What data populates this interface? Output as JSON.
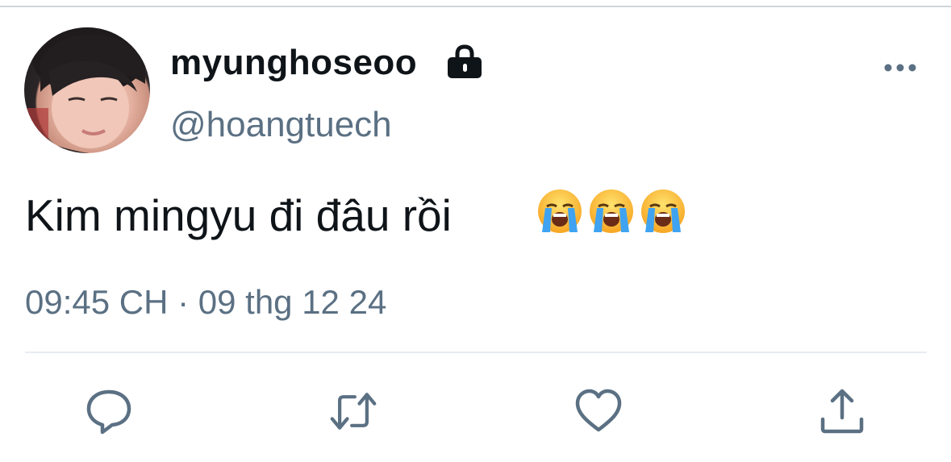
{
  "tweet": {
    "author": {
      "display_name": "myunghoseoo",
      "handle": "@hoangtuech",
      "protected_icon": "lock-icon",
      "avatar": "avatar"
    },
    "text": "Kim mingyu đi đâu rồi",
    "emojis": [
      "loudly-crying-face",
      "loudly-crying-face",
      "loudly-crying-face"
    ],
    "timestamp": "09:45 CH · 09 thg 12 24",
    "menu_icon": "more-icon"
  },
  "actions": [
    {
      "name": "reply",
      "icon": "reply-icon"
    },
    {
      "name": "retweet",
      "icon": "retweet-icon"
    },
    {
      "name": "like",
      "icon": "heart-icon"
    },
    {
      "name": "share",
      "icon": "share-icon"
    }
  ],
  "colors": {
    "text": "#0f1419",
    "secondary": "#5b7083",
    "divider": "#e6ecf0"
  }
}
